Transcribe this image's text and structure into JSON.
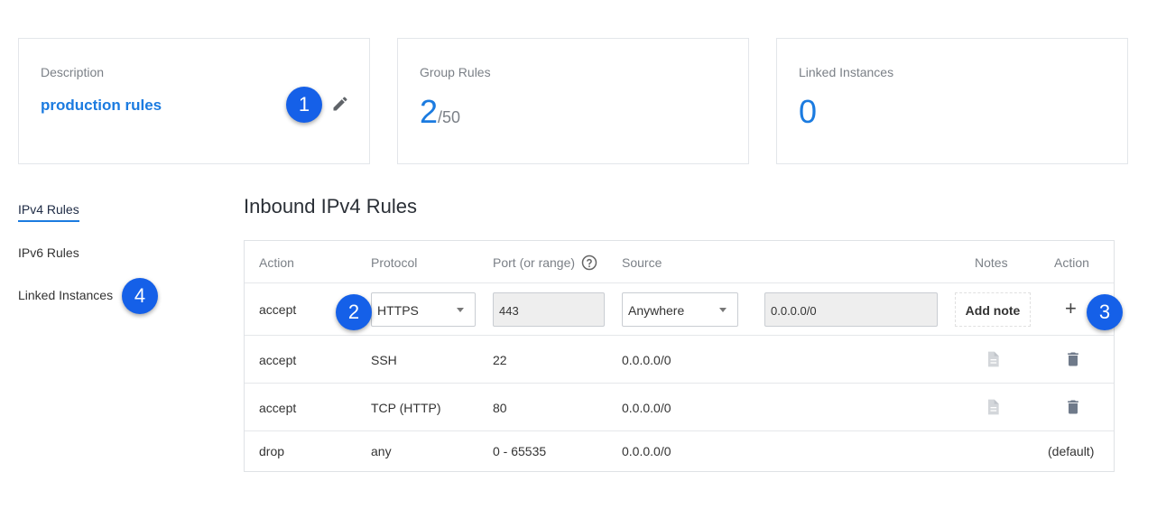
{
  "cards": {
    "description": {
      "label": "Description",
      "value": "production rules"
    },
    "group_rules": {
      "label": "Group Rules",
      "count": "2",
      "max": "/50"
    },
    "linked_instances": {
      "label": "Linked Instances",
      "count": "0"
    }
  },
  "sidebar": {
    "items": [
      {
        "label": "IPv4 Rules",
        "active": true
      },
      {
        "label": "IPv6 Rules",
        "active": false
      },
      {
        "label": "Linked Instances",
        "active": false
      }
    ]
  },
  "section": {
    "title": "Inbound IPv4 Rules"
  },
  "table": {
    "headers": {
      "action": "Action",
      "protocol": "Protocol",
      "port": "Port (or range)",
      "source": "Source",
      "notes": "Notes",
      "action2": "Action"
    },
    "edit_row": {
      "action": "accept",
      "protocol_selected": "HTTPS",
      "port_value": "443",
      "source_selected": "Anywhere",
      "source_value": "0.0.0.0/0",
      "add_note_label": "Add note",
      "add_label": "+"
    },
    "rows": [
      {
        "action": "accept",
        "protocol": "SSH",
        "port": "22",
        "source": "0.0.0.0/0"
      },
      {
        "action": "accept",
        "protocol": "TCP (HTTP)",
        "port": "80",
        "source": "0.0.0.0/0"
      },
      {
        "action": "drop",
        "protocol": "any",
        "port": "0 - 65535",
        "source": "0.0.0.0/0",
        "action_text": "(default)"
      }
    ]
  },
  "callouts": [
    "1",
    "2",
    "3",
    "4"
  ],
  "colors": {
    "accent": "#1b7be0",
    "badge": "#1560e8",
    "muted": "#7b8087"
  },
  "icons": [
    "pencil-icon",
    "help-icon",
    "caret-down-icon",
    "plus-icon",
    "note-icon",
    "trash-icon"
  ]
}
